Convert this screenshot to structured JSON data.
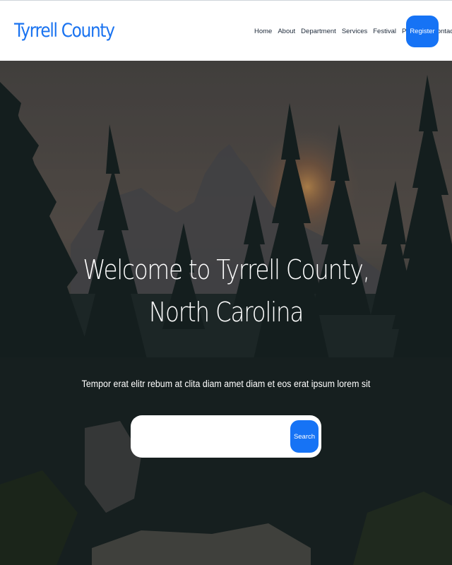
{
  "navbar": {
    "brand": "Tyrrell County",
    "links": [
      "Home",
      "About",
      "Department",
      "Services",
      "Festival",
      "Pages",
      "Contact"
    ],
    "pages_dropdown_icon": "caret-down-icon",
    "register_label": "Register"
  },
  "hero": {
    "title_line1": "Welcome to Tyrrell County,",
    "title_line2": "North Carolina",
    "subtitle": "Tempor erat elitr rebum at clita diam amet diam et eos erat ipsum lorem sit",
    "search": {
      "value": "",
      "button_label": "Search"
    }
  },
  "colors": {
    "brand": "#1a73f0",
    "primary_button": "#1673f5",
    "nav_text": "#1e2a3a"
  }
}
